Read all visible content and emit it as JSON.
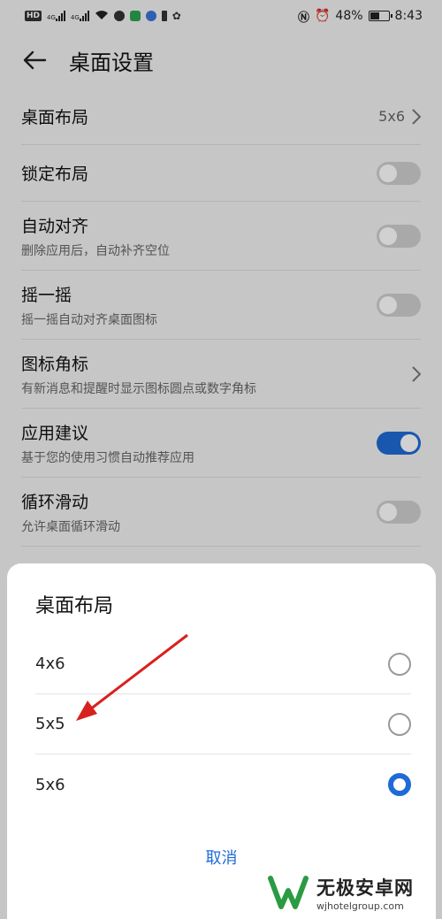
{
  "status_bar": {
    "left_text": "HD",
    "signal1": "4G",
    "signal2": "4G",
    "battery": "48%",
    "time": "8:43"
  },
  "header": {
    "title": "桌面设置"
  },
  "settings": [
    {
      "title": "桌面布局",
      "value": "5x6",
      "control": "chevron"
    },
    {
      "title": "锁定布局",
      "control": "toggle",
      "on": false
    },
    {
      "title": "自动对齐",
      "subtitle": "删除应用后，自动补齐空位",
      "control": "toggle",
      "on": false
    },
    {
      "title": "摇一摇",
      "subtitle": "摇一摇自动对齐桌面图标",
      "control": "toggle",
      "on": false
    },
    {
      "title": "图标角标",
      "subtitle": "有新消息和提醒时显示图标圆点或数字角标",
      "control": "chevron"
    },
    {
      "title": "应用建议",
      "subtitle": "基于您的使用习惯自动推荐应用",
      "control": "toggle",
      "on": true
    },
    {
      "title": "循环滑动",
      "subtitle": "允许桌面循环滑动",
      "control": "toggle",
      "on": false
    }
  ],
  "dialog": {
    "title": "桌面布局",
    "options": [
      {
        "label": "4x6",
        "selected": false
      },
      {
        "label": "5x5",
        "selected": false
      },
      {
        "label": "5x6",
        "selected": true
      }
    ],
    "cancel": "取消"
  },
  "watermark": {
    "name": "无极安卓网",
    "url": "wjhotelgroup.com"
  },
  "colors": {
    "accent": "#1f6bd6",
    "annotation_arrow": "#d8211e"
  }
}
